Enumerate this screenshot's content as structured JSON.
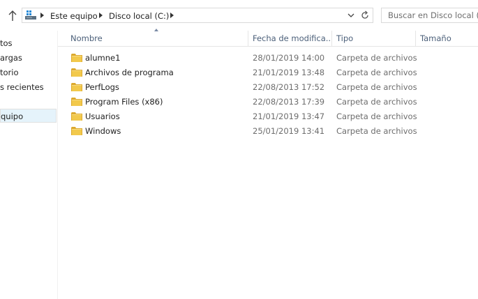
{
  "address_bar": {
    "breadcrumbs": [
      "Este equipo",
      "Disco local (C:)"
    ]
  },
  "search": {
    "placeholder": "Buscar en Disco local (C:)"
  },
  "nav_pane": {
    "items": [
      {
        "label": "tos"
      },
      {
        "label": "argas"
      },
      {
        "label": "torio"
      },
      {
        "label": "s recientes"
      },
      {
        "label": "quipo",
        "selected": true
      }
    ]
  },
  "file_list": {
    "columns": [
      "Nombre",
      "Fecha de modifica...",
      "Tipo",
      "Tamaño"
    ],
    "sort_column": "Nombre",
    "rows": [
      {
        "name": "alumne1",
        "date": "28/01/2019 14:00",
        "type": "Carpeta de archivos"
      },
      {
        "name": "Archivos de programa",
        "date": "21/01/2019 13:48",
        "type": "Carpeta de archivos"
      },
      {
        "name": "PerfLogs",
        "date": "22/08/2013 17:52",
        "type": "Carpeta de archivos"
      },
      {
        "name": "Program Files (x86)",
        "date": "22/08/2013 17:39",
        "type": "Carpeta de archivos"
      },
      {
        "name": "Usuarios",
        "date": "21/01/2019 13:47",
        "type": "Carpeta de archivos"
      },
      {
        "name": "Windows",
        "date": "25/01/2019 13:41",
        "type": "Carpeta de archivos"
      }
    ]
  },
  "colors": {
    "folder": "#e8b93a",
    "header_text": "#4c607a",
    "secondary_text": "#6d6d6d",
    "selection": "#e5f3fb"
  },
  "icons": [
    "up-arrow-icon",
    "computer-icon",
    "breadcrumb-separator-icon",
    "chevron-down-icon",
    "refresh-icon",
    "folder-icon"
  ]
}
